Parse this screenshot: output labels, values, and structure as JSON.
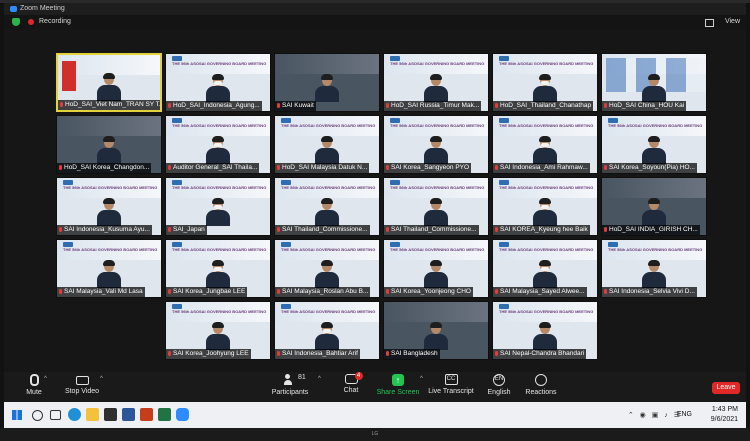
{
  "window": {
    "title": "Zoom Meeting",
    "view_label": "View"
  },
  "recording": {
    "label": "Recording"
  },
  "participants": [
    {
      "label": "HoD_SAI_Viet Nam_TRAN SY T...",
      "variant": "vn"
    },
    {
      "label": "HoD_SAI_Indonesia_Agung...",
      "variant": "banner"
    },
    {
      "label": "SAI Kuwait",
      "variant": "dark"
    },
    {
      "label": "HoD_SAI Russia_Timur Mak...",
      "variant": "banner"
    },
    {
      "label": "HoD_SAI_Thailand_Chanathap",
      "variant": "banner"
    },
    {
      "label": "HoD_SAI China_HOU Kai",
      "variant": "flag"
    },
    {
      "label": "HoD_SAI Korea_Changdon...",
      "variant": "dark"
    },
    {
      "label": "Auditor General_SAI Thaila...",
      "variant": "banner"
    },
    {
      "label": "HoD_SAI Malaysia Datuk N...",
      "variant": "banner"
    },
    {
      "label": "SAI Korea_Sangyeon PYO",
      "variant": "banner"
    },
    {
      "label": "SAI Indonesia_Ami Rahmaw...",
      "variant": "banner"
    },
    {
      "label": "SAI Korea_Soyoun(Pia) HO...",
      "variant": "banner"
    },
    {
      "label": "SAI Indonesia_Kusuma Ayu...",
      "variant": "banner"
    },
    {
      "label": "SAI_Japan",
      "variant": "banner"
    },
    {
      "label": "SAI Thailand_Commissione...",
      "variant": "banner"
    },
    {
      "label": "SAI Thailand_Commissione...",
      "variant": "banner"
    },
    {
      "label": "SAI KOREA_Kyeung hee Baik",
      "variant": "banner"
    },
    {
      "label": "HoD_SAI INDIA_GIRISH CH...",
      "variant": "dark"
    },
    {
      "label": "SAI Malaysia_Vali Md Lasa",
      "variant": "banner"
    },
    {
      "label": "SAI Korea_Jungbae LEE",
      "variant": "banner"
    },
    {
      "label": "SAI Malaysia_Roslan Abu B...",
      "variant": "banner"
    },
    {
      "label": "SAI Korea_Yoonjeong CHO",
      "variant": "banner"
    },
    {
      "label": "SAI Malaysia_Sayed Alwee...",
      "variant": "banner"
    },
    {
      "label": "SAI Indonesia_Selvia Vivi D...",
      "variant": "banner"
    },
    {
      "label": "SAI Korea_Joohyung LEE",
      "variant": "banner"
    },
    {
      "label": "SAI Indonesia_Bahtiar Arif",
      "variant": "banner"
    },
    {
      "label": "SAI Bangladesh",
      "variant": "dark"
    },
    {
      "label": "SAI Nepal-Chandra Bhandari",
      "variant": "banner"
    }
  ],
  "banner_text": "THE 56th ASOSAI GOVERNING BOARD MEETING",
  "banner_org": "ASOSAI",
  "toolbar": {
    "mute": "Mute",
    "stop_video": "Stop Video",
    "participants": "Participants",
    "participants_count": "81",
    "chat": "Chat",
    "chat_badge": "4",
    "share_screen": "Share Screen",
    "live_transcript": "Live Transcript",
    "cc": "CC",
    "english": "English",
    "en": "EN",
    "reactions": "Reactions",
    "leave": "Leave"
  },
  "taskbar": {
    "language": "ENG",
    "time": "1:43 PM",
    "date": "9/6/2021"
  },
  "monitor_brand": "LG",
  "colors": {
    "share_green": "#23c552",
    "leave_red": "#e02828",
    "zoom_blue": "#2d8cff",
    "active_speaker": "#e3d23a"
  }
}
